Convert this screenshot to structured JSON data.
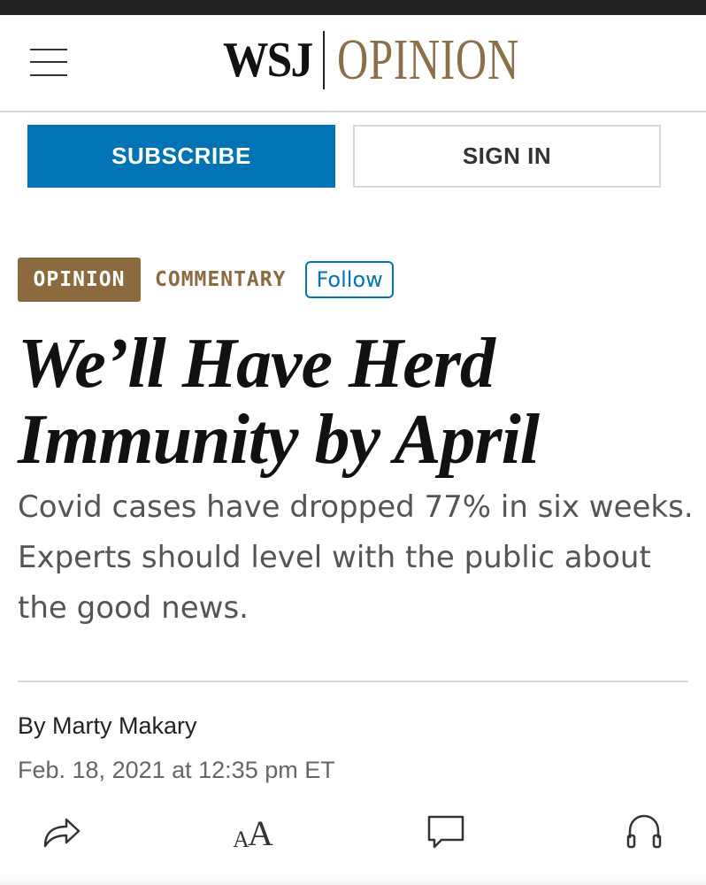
{
  "header": {
    "brand": "WSJ",
    "section": "OPINION",
    "menu_icon": "hamburger-menu-icon"
  },
  "auth": {
    "subscribe_label": "SUBSCRIBE",
    "signin_label": "SIGN IN"
  },
  "article": {
    "flag": "OPINION",
    "category": "COMMENTARY",
    "follow_label": "Follow",
    "headline_line1": "We’ll Have Herd",
    "headline_line2": "Immunity by April",
    "dek": "Covid cases have dropped 77% in six weeks. Experts should level with the public about the good news.",
    "byline_prefix": "By",
    "author": "Marty Makary",
    "timestamp": "Feb. 18, 2021 at 12:35 pm ET"
  },
  "toolbar": {
    "share_icon": "share-icon",
    "text_size_small": "A",
    "text_size_large": "A",
    "comment_icon": "comment-icon",
    "audio_icon": "headphones-icon"
  },
  "colors": {
    "subscribe_bg": "#0274b6",
    "opinion_brown": "#8b6a3e",
    "masthead_gold": "#8b6f47",
    "follow_blue": "#0274b6"
  }
}
